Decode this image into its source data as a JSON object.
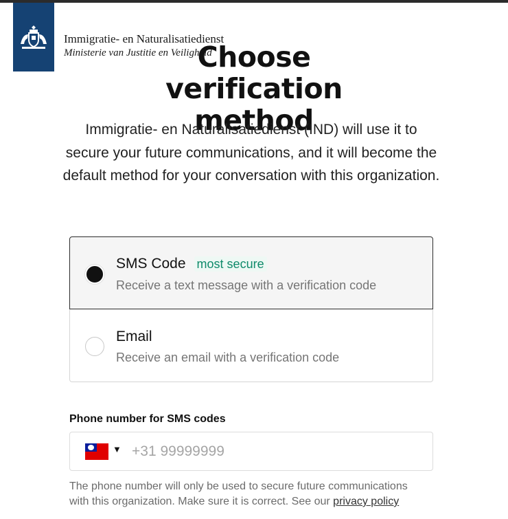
{
  "brand": {
    "org_line1": "Immigratie- en Naturalisatiedienst",
    "org_line2": "Ministerie van Justitie en Veiligheid",
    "logo_color": "#154273"
  },
  "page": {
    "title": "Choose verification method",
    "intro": "Immigratie- en Naturalisatiedienst (IND) will use it to secure your future communications, and it will become the default method for your conversation with this organization."
  },
  "options": [
    {
      "title": "SMS Code",
      "badge": "most secure",
      "description": "Receive a text message with a verification code",
      "selected": true
    },
    {
      "title": "Email",
      "badge": "",
      "description": "Receive an email with a verification code",
      "selected": false
    }
  ],
  "phone": {
    "label": "Phone number for SMS codes",
    "placeholder": "+31 99999999",
    "value": "",
    "country_flag": "taiwan-flag-icon"
  },
  "help": {
    "text": "The phone number will only be used to secure future communications with this organization. Make sure it is correct. See our",
    "link_label": "privacy policy"
  },
  "colors": {
    "badge_text": "#0f8a6a",
    "selected_border": "#2b2b2b",
    "muted_text": "#757575"
  }
}
